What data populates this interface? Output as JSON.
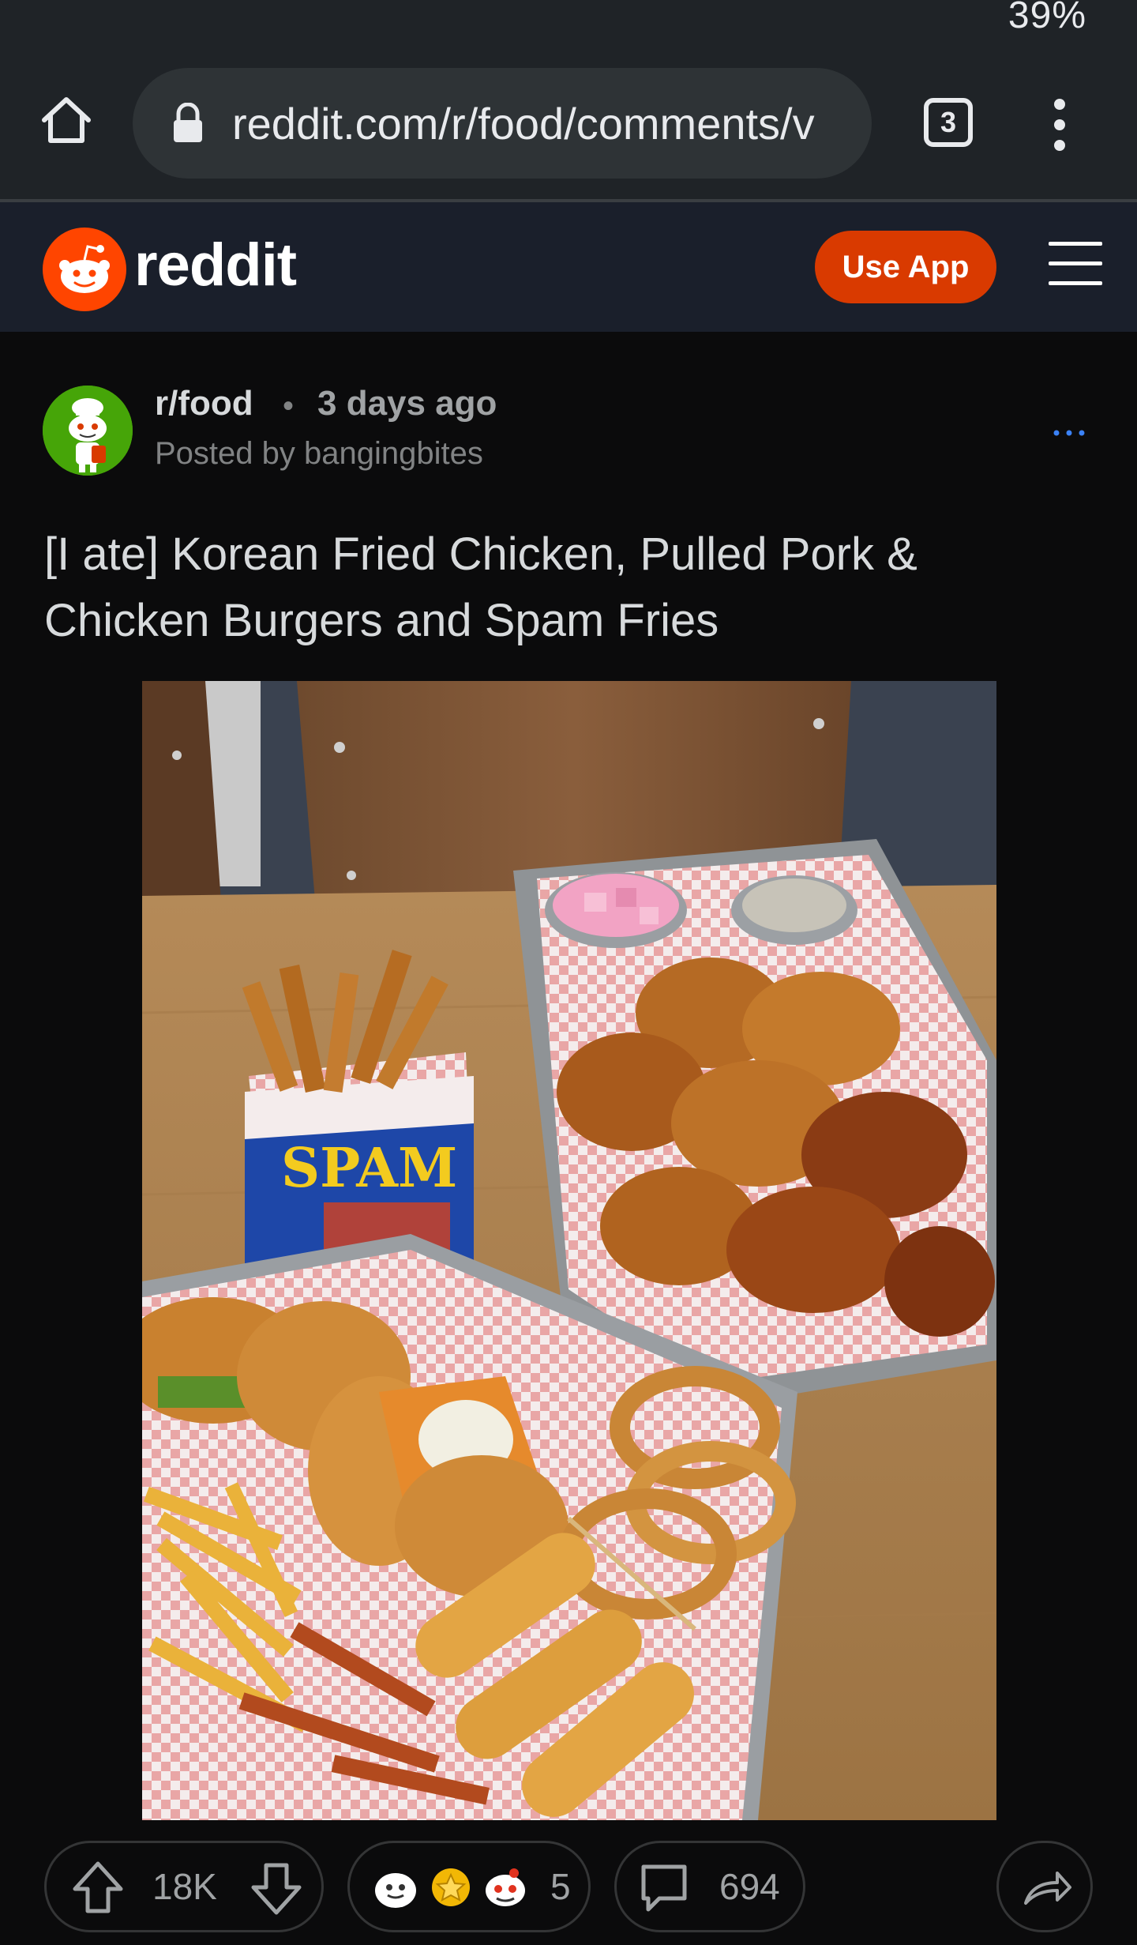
{
  "status_bar": {
    "battery": "39%"
  },
  "browser": {
    "url": "reddit.com/r/food/comments/v",
    "tab_count": "3"
  },
  "reddit_header": {
    "logo_text": "reddit",
    "use_app_label": "Use App"
  },
  "post": {
    "subreddit": "r/food",
    "separator": "•",
    "time": "3 days ago",
    "posted_by": "Posted by bangingbites",
    "title": "[I ate] Korean Fried Chicken, Pulled Pork & Chicken Burgers and Spam Fries",
    "spam_label": "SPAM",
    "upvotes": "18K",
    "award_count": "5",
    "comment_count": "694"
  },
  "colors": {
    "accent": "#d93a00",
    "background": "#0b0b0c",
    "header_bg": "#1a1f2b",
    "browser_bg": "#1f2327"
  }
}
